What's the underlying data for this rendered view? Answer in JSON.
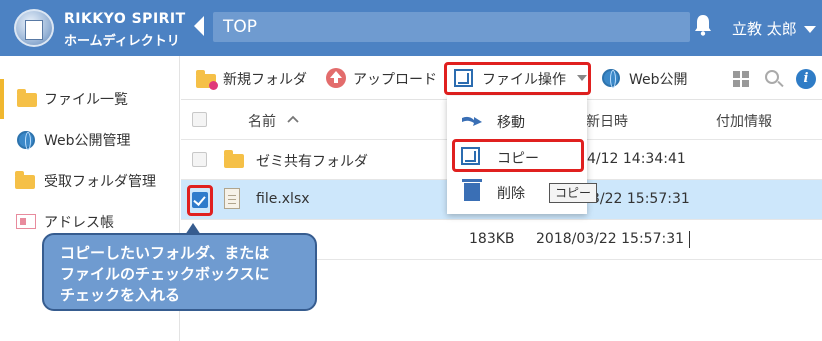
{
  "header": {
    "brand_top": "RIKKYO SPIRIT",
    "brand_bottom": "ホームディレクトリ",
    "path": "TOP",
    "user": "立教 太郎",
    "bg_color": "#4c82c3"
  },
  "sidebar": {
    "items": [
      {
        "label": "ファイル一覧",
        "icon": "folder-icon"
      },
      {
        "label": "Web公開管理",
        "icon": "globe-icon"
      },
      {
        "label": "受取フォルダ管理",
        "icon": "folder-globe-icon"
      },
      {
        "label": "アドレス帳",
        "icon": "address-card-icon"
      }
    ]
  },
  "toolbar": {
    "new_folder": "新規フォルダ",
    "upload": "アップロード",
    "file_ops": "ファイル操作",
    "web_publish": "Web公開"
  },
  "table": {
    "headers": {
      "name": "名前",
      "modified": "更新日時",
      "extra": "付加情報"
    },
    "rows": [
      {
        "name": "ゼミ共有フォルダ",
        "size": "",
        "modified": "2018/04/12 14:34:41",
        "type": "folder"
      },
      {
        "name": "file.xlsx",
        "size": "183KB",
        "modified": "2018/03/22 15:57:31",
        "type": "file",
        "selected": true
      }
    ],
    "visible": {
      "row1_date": "4/12 14:34:41",
      "row2_date": "3/22 15:57:31",
      "hdr_date": "更新日時",
      "row3_size": "183KB",
      "row3_date": "2018/03/22 15:57:31"
    }
  },
  "dropdown": {
    "items": [
      {
        "label": "移動",
        "icon": "move-arrow-icon"
      },
      {
        "label": "コピー",
        "icon": "copy-icon"
      },
      {
        "label": "削除",
        "icon": "trash-icon"
      }
    ]
  },
  "tooltip": "コピー",
  "callout": {
    "lines": [
      "コピーしたいフォルダ、または",
      "ファイルのチェックボックスに",
      "チェックを入れる"
    ]
  }
}
